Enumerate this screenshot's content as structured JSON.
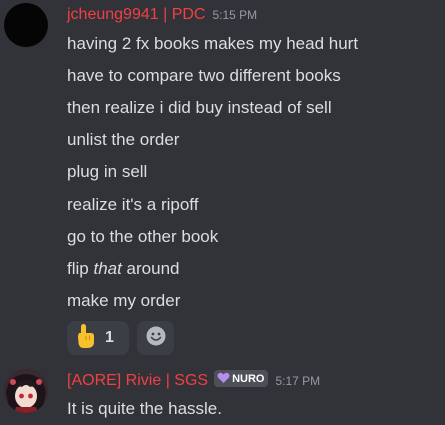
{
  "messages": [
    {
      "author": "jcheung9941 | PDC",
      "time": "5:15 PM",
      "lines": [
        {
          "text": "having 2 fx books makes my head hurt"
        },
        {
          "text": "have to compare two different books"
        },
        {
          "text": "then realize i did buy instead of sell"
        },
        {
          "text": "unlist the order"
        },
        {
          "text": "plug in sell"
        },
        {
          "text": "realize it's a ripoff"
        },
        {
          "text": "go to the other book"
        },
        {
          "pre": "flip ",
          "em": "that",
          "post": " around"
        },
        {
          "text": "make my order"
        }
      ],
      "reactions": [
        {
          "emoji": "pointing-up-hand",
          "count": "1"
        }
      ],
      "add_reaction_icon": "smiley-icon"
    },
    {
      "author": "[AORE] Rivie | SGS",
      "tag": {
        "icon": "heart-icon",
        "label": "NURO",
        "color": "#b48ef0"
      },
      "time": "5:17 PM",
      "lines": [
        {
          "text": "It is quite the hassle."
        }
      ]
    }
  ],
  "colors": {
    "background": "#323339",
    "username": "#f23f43",
    "text": "#dbdee1",
    "timestamp": "#949ba4",
    "reaction_bg": "#3c3e45",
    "tag_bg": "#4e5058"
  }
}
